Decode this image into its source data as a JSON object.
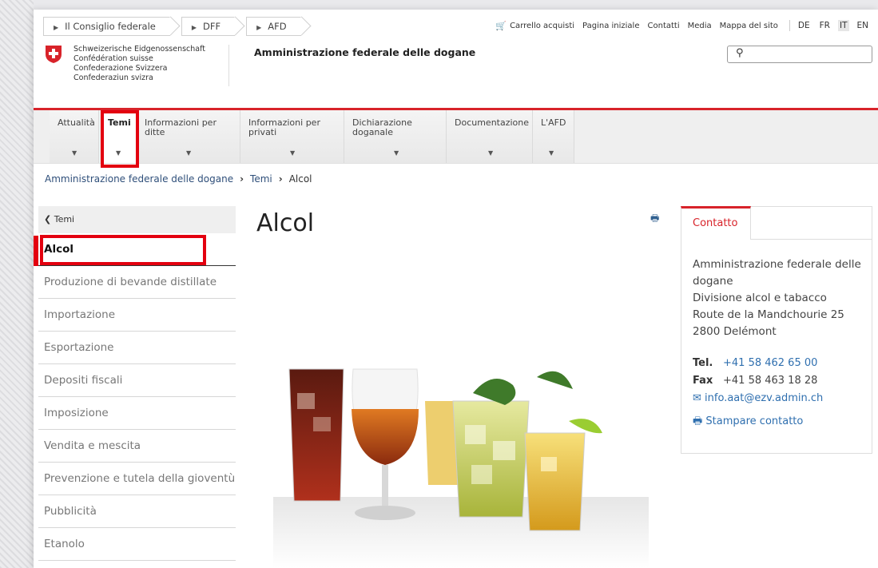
{
  "topbar": {
    "crumbs": [
      "Il Consiglio federale",
      "DFF",
      "AFD"
    ],
    "links": [
      "Carrello acquisti",
      "Pagina iniziale",
      "Contatti",
      "Media",
      "Mappa del sito"
    ],
    "languages": [
      "DE",
      "FR",
      "IT",
      "EN"
    ],
    "active_language": "IT"
  },
  "brand": {
    "lines": [
      "Schweizerische Eidgenossenschaft",
      "Confédération suisse",
      "Confederazione Svizzera",
      "Confederaziun svizra"
    ],
    "agency": "Amministrazione federale delle dogane"
  },
  "mainnav": {
    "items": [
      "Attualità",
      "Temi",
      "Informazioni per ditte",
      "Informazioni per privati",
      "Dichiarazione doganale",
      "Documentazione",
      "L'AFD"
    ],
    "active": "Temi"
  },
  "breadcrumb": [
    "Amministrazione federale delle dogane",
    "Temi",
    "Alcol"
  ],
  "leftnav": {
    "back": "Temi",
    "items": [
      "Alcol",
      "Produzione di bevande distillate",
      "Importazione",
      "Esportazione",
      "Depositi fiscali",
      "Imposizione",
      "Vendita e mescita",
      "Prevenzione e tutela della gioventù",
      "Pubblicità",
      "Etanolo"
    ],
    "active": "Alcol"
  },
  "page": {
    "title": "Alcol"
  },
  "contact": {
    "tab": "Contatto",
    "address": [
      "Amministrazione federale delle dogane",
      "Divisione alcol e tabacco",
      "Route de la Mandchourie 25",
      "2800 Delémont"
    ],
    "tel_label": "Tel.",
    "tel": "+41 58 462 65 00",
    "fax_label": "Fax",
    "fax": "+41 58 463 18 28",
    "email": "info.aat@ezv.admin.ch",
    "print": "Stampare contatto"
  },
  "colors": {
    "accent_red": "#d8232a",
    "link_blue": "#2f6faf",
    "highlight": "#e3000f"
  }
}
